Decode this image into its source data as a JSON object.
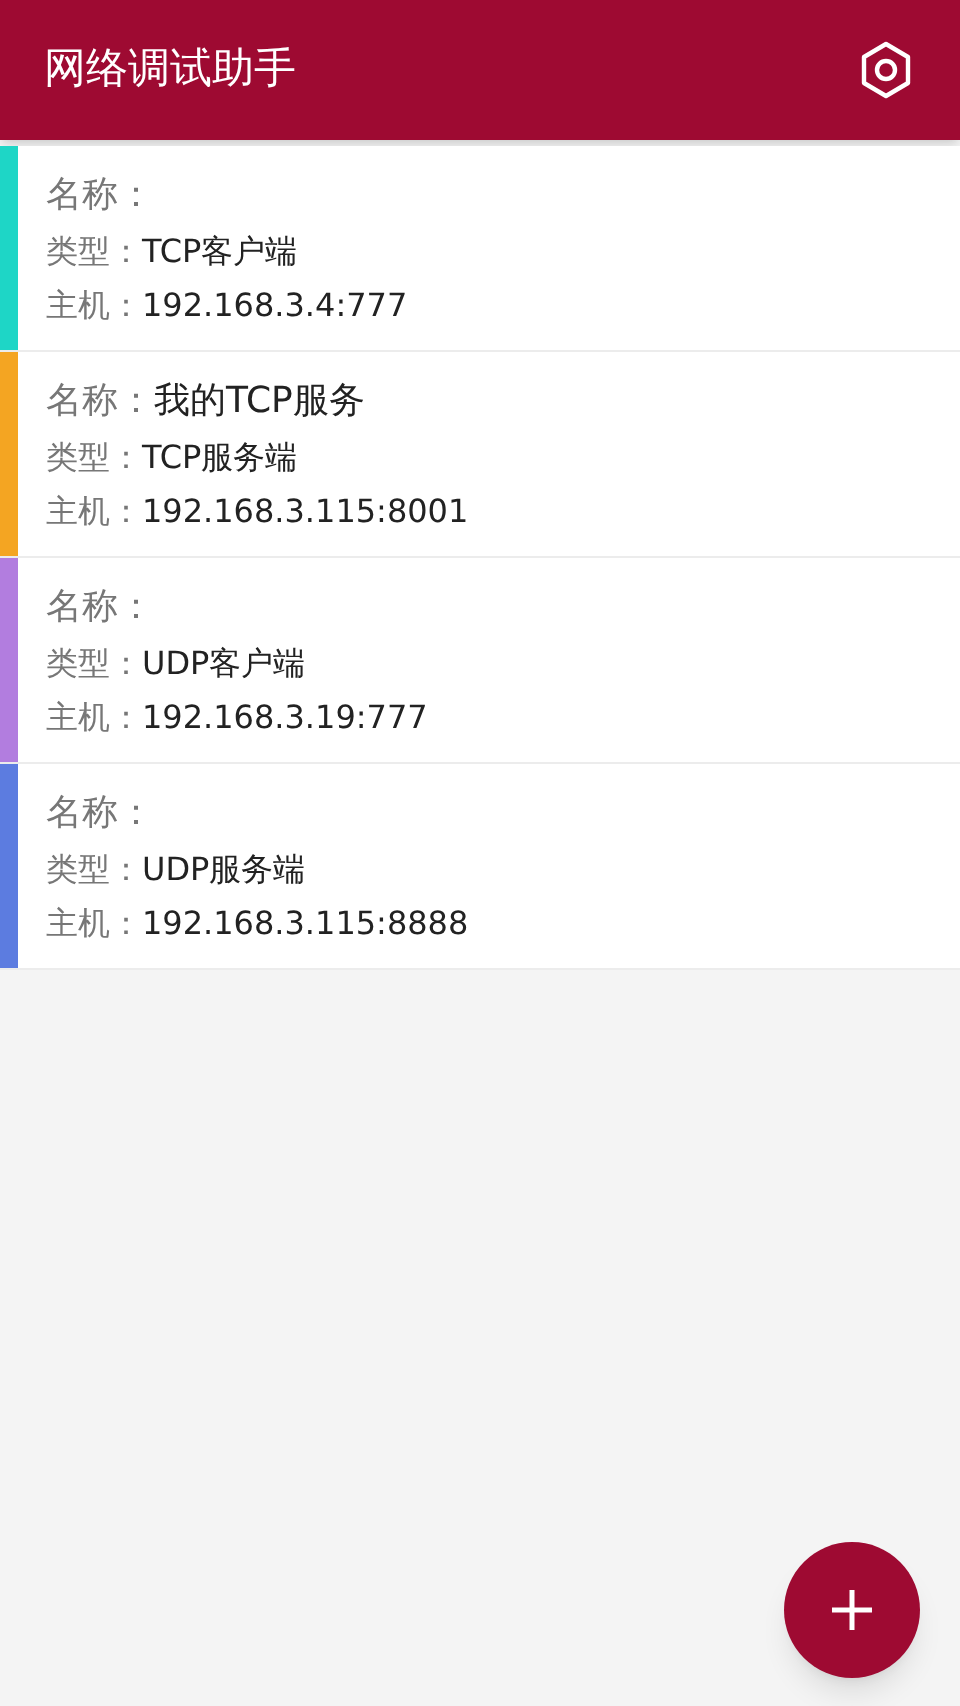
{
  "app_bar": {
    "title": "网络调试助手"
  },
  "connections": [
    {
      "color": "#1ed6c6",
      "name_label": "名称：",
      "type_label": "类型：",
      "type": "TCP客户端",
      "host_label": "主机：",
      "host": "192.168.3.4:777"
    },
    {
      "color": "#f4a522",
      "name_label": "名称：",
      "name": "我的TCP服务",
      "type_label": "类型：",
      "type": "TCP服务端",
      "host_label": "主机：",
      "host": "192.168.3.115:8001"
    },
    {
      "color": "#b27ddf",
      "name_label": "名称：",
      "type_label": "类型：",
      "type": "UDP客户端",
      "host_label": "主机：",
      "host": "192.168.3.19:777"
    },
    {
      "color": "#5c7ce0",
      "name_label": "名称：",
      "type_label": "类型：",
      "type": "UDP服务端",
      "host_label": "主机：",
      "host": "192.168.3.115:8888"
    }
  ]
}
